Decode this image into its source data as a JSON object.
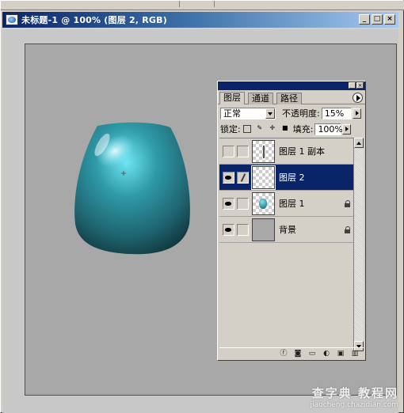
{
  "window": {
    "title": "未标题-1 @ 100% (图层 2, RGB)",
    "minimize": "_",
    "maximize": "□",
    "close": "×"
  },
  "canvas": {
    "background_color": "#a8a8a8",
    "object": "teal-vase",
    "object_color": "#2b8a96"
  },
  "layers_panel": {
    "tabs": [
      {
        "label": "图层",
        "active": true
      },
      {
        "label": "通道",
        "active": false
      },
      {
        "label": "路径",
        "active": false
      }
    ],
    "blend_mode": "正常",
    "opacity_label": "不透明度:",
    "opacity_value": "15%",
    "lock_label": "锁定:",
    "fill_label": "填充:",
    "fill_value": "100%",
    "layers": [
      {
        "name": "图层 1 副本",
        "visible": false,
        "selected": false,
        "locked": false
      },
      {
        "name": "图层 2",
        "visible": true,
        "selected": true,
        "locked": false
      },
      {
        "name": "图层 1",
        "visible": true,
        "selected": false,
        "locked": true
      },
      {
        "name": "背景",
        "visible": true,
        "selected": false,
        "locked": true
      }
    ],
    "bottom_icons": [
      "layer-style-icon",
      "mask-icon",
      "folder-icon",
      "adjustment-icon",
      "new-layer-icon",
      "trash-icon"
    ]
  },
  "watermark": {
    "main": "查字典 教程网",
    "sub": "jiaocheng.chazidian.com"
  }
}
